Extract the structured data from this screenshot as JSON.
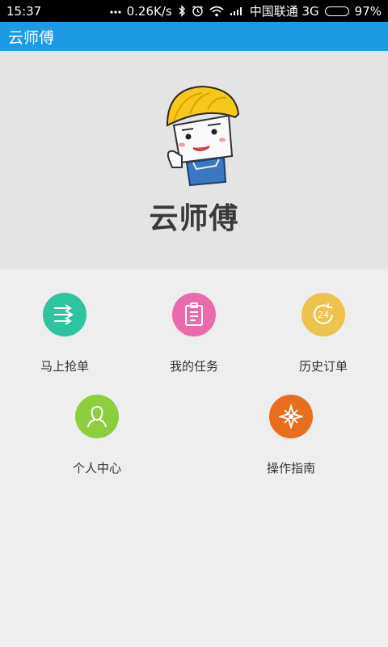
{
  "status_bar": {
    "time": "15:37",
    "speed": "0.26K/s",
    "carrier": "中国联通 3G",
    "battery": "97%",
    "battery_level": 0.97
  },
  "app_bar": {
    "title": "云师傅"
  },
  "banner": {
    "logo_text": "云师傅"
  },
  "menu": [
    {
      "label": "马上抢单",
      "icon": "grab-order-icon",
      "color": "#2ec4a0"
    },
    {
      "label": "我的任务",
      "icon": "task-list-icon",
      "color": "#ea6aab"
    },
    {
      "label": "历史订单",
      "icon": "history-24-icon",
      "color": "#ecc34d"
    },
    {
      "label": "个人中心",
      "icon": "user-icon",
      "color": "#8cce3e"
    },
    {
      "label": "操作指南",
      "icon": "compass-icon",
      "color": "#e86d1d"
    }
  ]
}
